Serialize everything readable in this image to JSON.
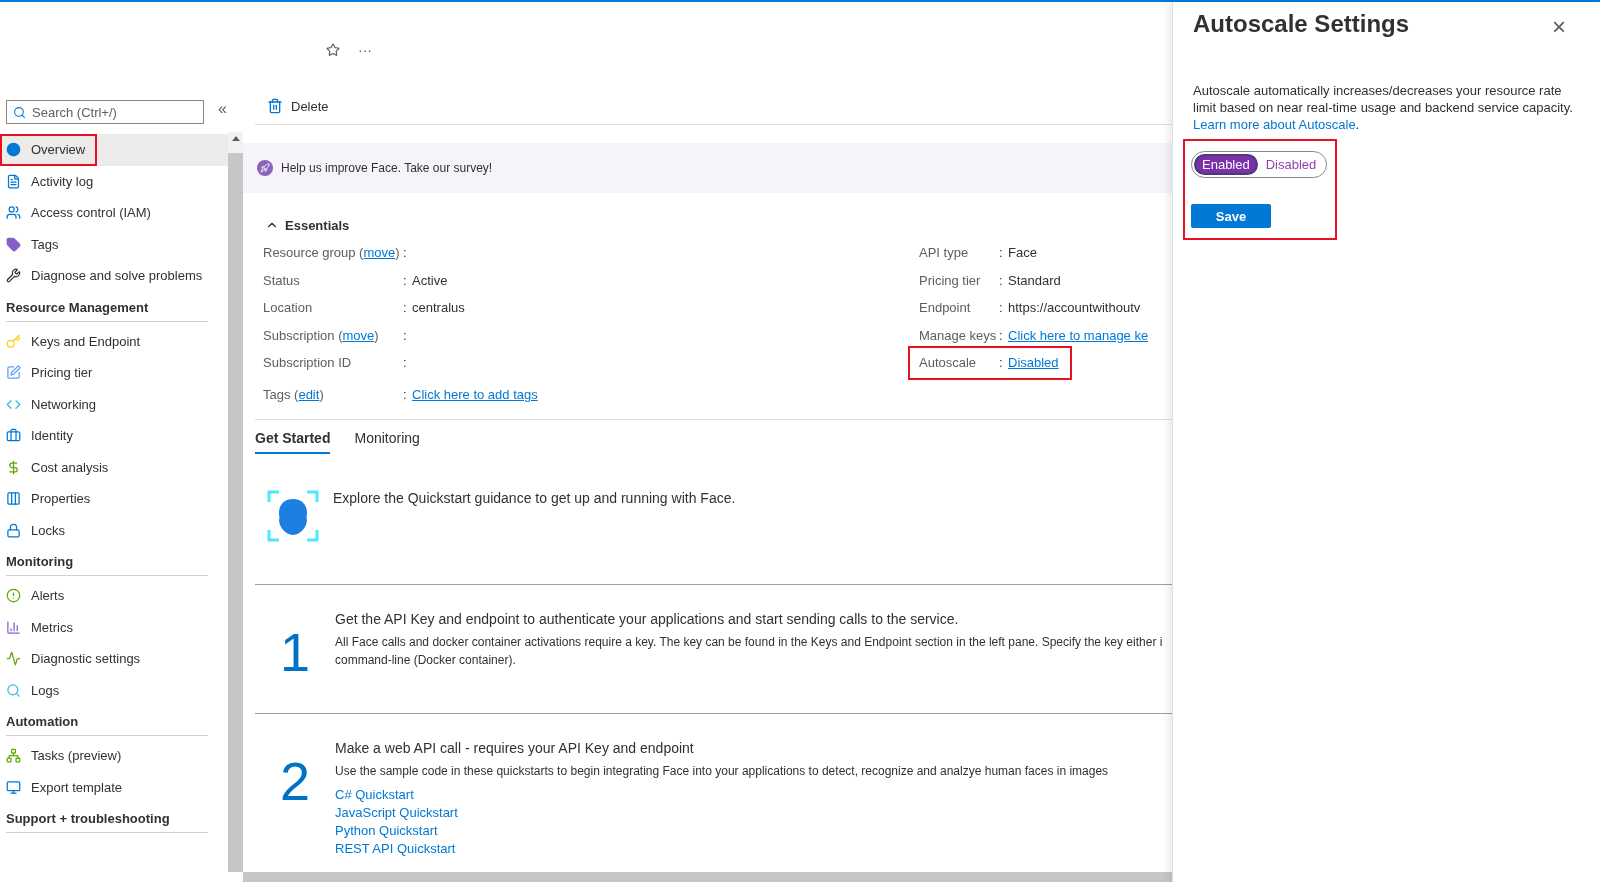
{
  "header": {
    "actions": [
      {
        "kind": "favorite"
      },
      {
        "kind": "more",
        "text": "···"
      }
    ]
  },
  "sidebar": {
    "search": {
      "placeholder": "Search (Ctrl+/)"
    },
    "collapse": "«",
    "groups": [
      {
        "items": [
          {
            "label": "Overview",
            "selected": true,
            "highlighted": true
          },
          {
            "label": "Activity log",
            "selected": false,
            "highlighted": false
          },
          {
            "label": "Access control (IAM)",
            "selected": false,
            "highlighted": false
          },
          {
            "label": "Tags",
            "selected": false,
            "highlighted": false
          },
          {
            "label": "Diagnose and solve problems",
            "selected": false,
            "highlighted": false
          }
        ]
      },
      {
        "title": "Resource Management",
        "items": [
          {
            "label": "Keys and Endpoint",
            "selected": false,
            "highlighted": false
          },
          {
            "label": "Pricing tier",
            "selected": false,
            "highlighted": false
          },
          {
            "label": "Networking",
            "selected": false,
            "highlighted": false
          },
          {
            "label": "Identity",
            "selected": false,
            "highlighted": false
          },
          {
            "label": "Cost analysis",
            "selected": false,
            "highlighted": false
          },
          {
            "label": "Properties",
            "selected": false,
            "highlighted": false
          },
          {
            "label": "Locks",
            "selected": false,
            "highlighted": false
          }
        ]
      },
      {
        "title": "Monitoring",
        "items": [
          {
            "label": "Alerts",
            "selected": false,
            "highlighted": false
          },
          {
            "label": "Metrics",
            "selected": false,
            "highlighted": false
          },
          {
            "label": "Diagnostic settings",
            "selected": false,
            "highlighted": false
          },
          {
            "label": "Logs",
            "selected": false,
            "highlighted": false
          }
        ]
      },
      {
        "title": "Automation",
        "items": [
          {
            "label": "Tasks (preview)",
            "selected": false,
            "highlighted": false
          },
          {
            "label": "Export template",
            "selected": false,
            "highlighted": false
          }
        ]
      },
      {
        "title": "Support + troubleshooting"
      }
    ]
  },
  "toolbar": {
    "delete": "Delete"
  },
  "banner": "Help us improve Face. Take our survey!",
  "essentials": {
    "title": "Essentials",
    "expanded": true,
    "left": [
      {
        "label": "Resource group (",
        "link": "move",
        "label_end": ")"
      },
      {
        "label": "Status",
        "value": "Active"
      },
      {
        "label": "Location",
        "value": "centralus"
      },
      {
        "label": "Subscription (",
        "link": "move",
        "label_end": ")"
      },
      {
        "label": "Subscription ID"
      },
      {
        "label": "Tags (",
        "link": "edit",
        "label_end": ")",
        "value_link": "Click here to add tags"
      }
    ],
    "right": [
      {
        "label": "API type",
        "value": "Face",
        "highlighted": false
      },
      {
        "label": "Pricing tier",
        "value": "Standard",
        "highlighted": false
      },
      {
        "label": "Endpoint",
        "value": "https://accountwithoutv",
        "highlighted": false
      },
      {
        "label": "Manage keys",
        "value_link": "Click here to manage ke",
        "highlighted": false
      },
      {
        "label": "Autoscale",
        "value_link": "Disabled",
        "highlighted": true
      }
    ],
    "separator": ":"
  },
  "tabs": [
    {
      "label": "Get Started",
      "selected": true
    },
    {
      "label": "Monitoring",
      "selected": false
    }
  ],
  "intro": "Explore the Quickstart guidance to get up and running with Face.",
  "steps": [
    {
      "number": "1",
      "heading": "Get the API Key and endpoint to authenticate your applications and start sending calls to the service.",
      "lines": [
        "All Face calls and docker container activations require a key. The key can be found in the Keys and Endpoint section in the left pane. Specify the key either i",
        "command-line (Docker container)."
      ]
    },
    {
      "number": "2",
      "heading": "Make a web API call - requires your API Key and endpoint",
      "lines": [
        "Use the sample code in these quickstarts to begin integrating Face into your applications to detect, recognize and analzye human faces in images"
      ],
      "links": [
        "C# Quickstart",
        "JavaScript Quickstart",
        "Python Quickstart",
        "REST API Quickstart"
      ]
    }
  ],
  "panel": {
    "title": "Autoscale Settings",
    "close": "×",
    "description": "Autoscale automatically increases/decreases your resource rate limit based on near real-time usage and backend service capacity. ",
    "link": "Learn more about Autoscale",
    "description_end": ".",
    "toggle": [
      {
        "label": "Enabled",
        "selected": true
      },
      {
        "label": "Disabled",
        "selected": false
      }
    ],
    "save": "Save",
    "highlighted": true
  }
}
